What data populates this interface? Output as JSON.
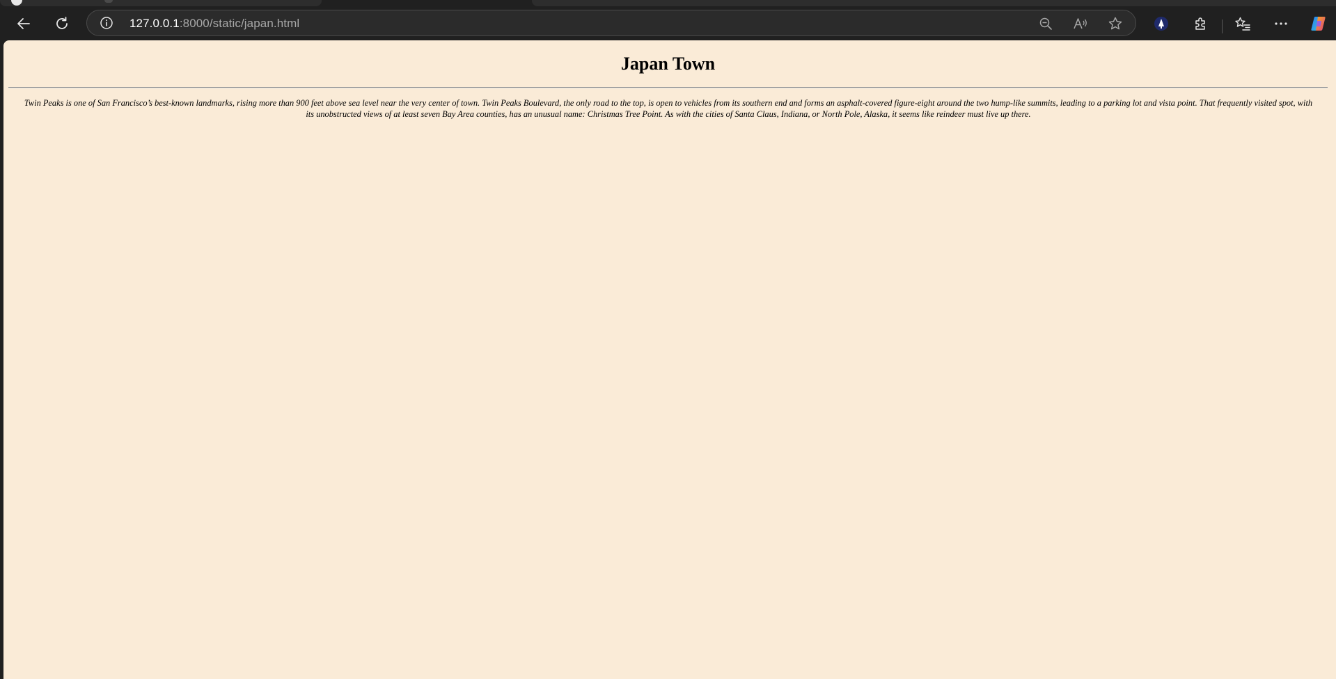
{
  "browser": {
    "url_host": "127.0.0.1",
    "url_path": ":8000/static/japan.html",
    "icons": {
      "back": "back-arrow-icon",
      "refresh": "refresh-icon",
      "site_info": "info-icon",
      "zoom": "zoom-out-icon",
      "read_aloud": "read-aloud-icon",
      "favorite": "star-icon",
      "extension_1": "tree-extension-icon",
      "extensions": "puzzle-icon",
      "favorites": "favorites-icon",
      "more": "more-icon",
      "copilot": "copilot-icon"
    }
  },
  "page": {
    "title": "Japan Town",
    "intro": "Twin Peaks is one of San Francisco’s best-known landmarks, rising more than 900 feet above sea level near the very center of town. Twin Peaks Boulevard, the only road to the top, is open to vehicles from its southern end and forms an asphalt-covered figure-eight around the two hump-like summits, leading to a parking lot and vista point. That frequently visited spot, with its unobstructed views of at least seven Bay Area counties, has an unusual name: Christmas Tree Point. As with the cities of Santa Claus, Indiana, or North Pole, Alaska, it seems like reindeer must live up there.",
    "background_color": "#faebd7"
  }
}
